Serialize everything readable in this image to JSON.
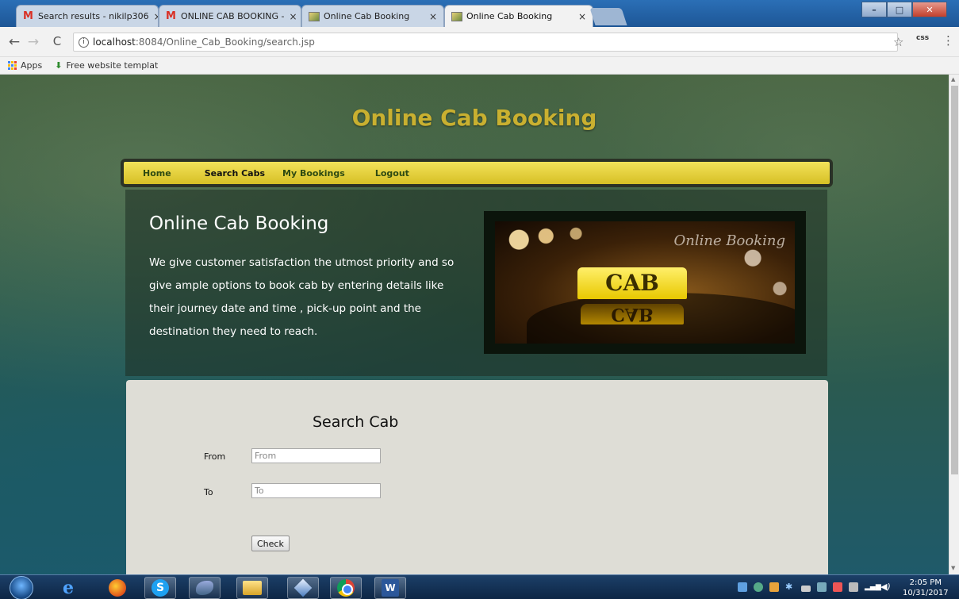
{
  "browser": {
    "tabs": [
      {
        "title": "Search results - nikilp306",
        "icon": "gmail-icon",
        "active": false
      },
      {
        "title": "ONLINE CAB BOOKING -",
        "icon": "gmail-icon",
        "active": false
      },
      {
        "title": "Online Cab Booking",
        "icon": "page-icon",
        "active": false
      },
      {
        "title": "Online Cab Booking",
        "icon": "page-icon",
        "active": true
      }
    ],
    "tab_close": "×",
    "address": {
      "host": "localhost",
      "path": ":8084/Online_Cab_Booking/search.jsp"
    },
    "extension_label": "css",
    "bookmarks": [
      {
        "label": "Apps",
        "icon": "apps-grid-icon"
      },
      {
        "label": "Free website templat",
        "icon": "download-icon"
      }
    ],
    "window_controls": [
      "minimize",
      "maximize",
      "close"
    ]
  },
  "page": {
    "site_title": "Online Cab Booking",
    "nav": [
      {
        "label": "Home",
        "active": false
      },
      {
        "label": "Search Cabs",
        "active": true
      },
      {
        "label": "My Bookings",
        "active": false
      },
      {
        "label": "Logout",
        "active": false
      }
    ],
    "hero": {
      "heading": "Online Cab Booking",
      "body": "We give customer satisfaction the utmost priority and so give ample options to book cab by entering details like their journey date and time , pick-up point and the destination they need to reach.",
      "image": {
        "script_text": "Online Booking",
        "sign_text": "CAB",
        "reflection_text": "CAB"
      }
    },
    "search": {
      "title": "Search Cab",
      "from_label": "From",
      "from_placeholder": "From",
      "to_label": "To",
      "to_placeholder": "To",
      "submit_label": "Check"
    }
  },
  "taskbar": {
    "time": "2:05 PM",
    "date": "10/31/2017",
    "pinned": [
      "internet-explorer-icon",
      "firefox-icon",
      "skype-icon",
      "dolphin-icon",
      "folder-icon",
      "virtualbox-icon",
      "chrome-icon",
      "word-icon"
    ]
  },
  "colors": {
    "site_title": "#c9b030",
    "nav_bar": "#e8d43a",
    "search_panel": "#deddd6"
  }
}
